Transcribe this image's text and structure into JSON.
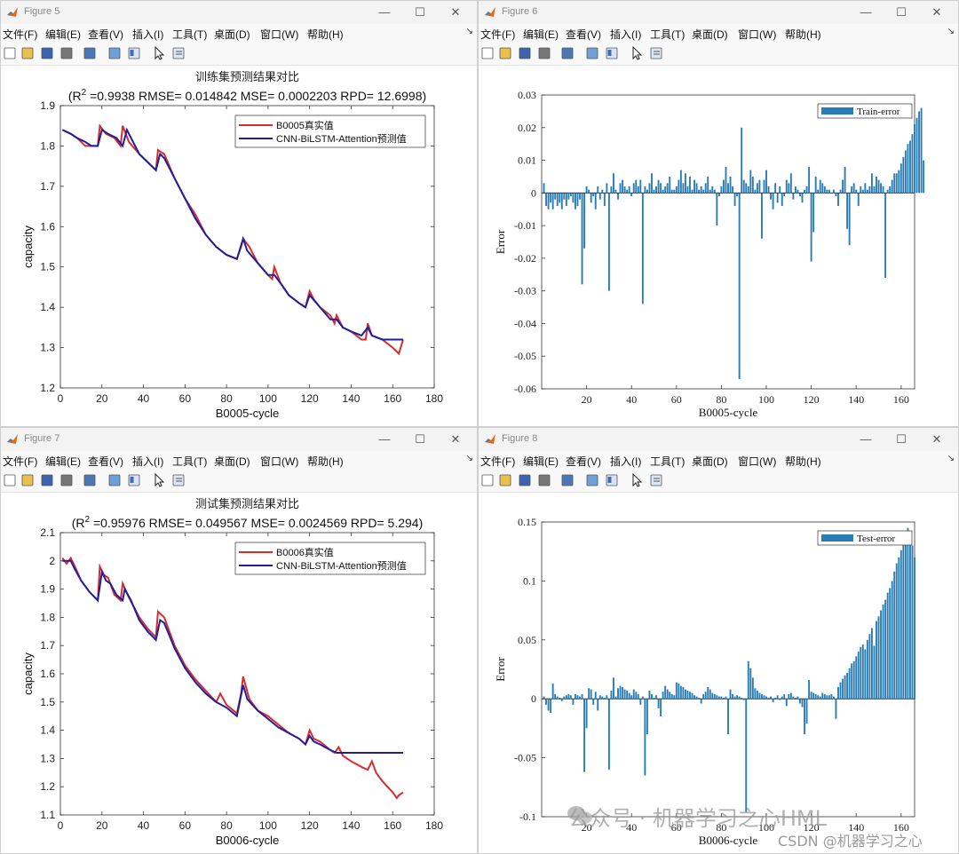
{
  "menu": [
    "文件(F)",
    "编辑(E)",
    "查看(V)",
    "插入(I)",
    "工具(T)",
    "桌面(D)",
    "窗口(W)",
    "帮助(H)"
  ],
  "window_controls": {
    "minimize": "—",
    "maximize": "☐",
    "close": "✕"
  },
  "toolbar_icons": [
    "new-figure-icon",
    "open-file-icon",
    "save-icon",
    "print-icon",
    "link-plot-icon",
    "colorbar-icon",
    "legend-icon",
    "edit-plot-icon",
    "property-inspector-icon"
  ],
  "windows": [
    {
      "title": "Figure 5",
      "chart_data": {
        "type": "line",
        "title": "训练集预测结果对比",
        "subtitle": {
          "r2_label": "(R",
          "r2_sup": "2",
          "rest": " =0.9938 RMSE= 0.014842 MSE= 0.0002203 RPD= 12.6998)"
        },
        "xlabel": "B0005-cycle",
        "ylabel": "capacity",
        "xlim": [
          0,
          180
        ],
        "ylim": [
          1.2,
          1.9
        ],
        "xticks": [
          "0",
          "20",
          "40",
          "60",
          "80",
          "100",
          "120",
          "140",
          "160",
          "180"
        ],
        "yticks": [
          "1.2",
          "1.3",
          "1.4",
          "1.5",
          "1.6",
          "1.7",
          "1.8",
          "1.9"
        ],
        "legend_position": "top-right",
        "series": [
          {
            "name": "B0005真实值",
            "color": "#d92b2b",
            "x": [
              1,
              5,
              8,
              12,
              15,
              18,
              19,
              22,
              26,
              29,
              30,
              33,
              38,
              42,
              46,
              47,
              50,
              55,
              60,
              65,
              70,
              75,
              80,
              85,
              87,
              88,
              91,
              95,
              100,
              102,
              103,
              106,
              110,
              115,
              118,
              120,
              122,
              125,
              130,
              132,
              133,
              136,
              140,
              145,
              147,
              148,
              150,
              155,
              160,
              162,
              163,
              165
            ],
            "y": [
              1.84,
              1.83,
              1.82,
              1.8,
              1.8,
              1.8,
              1.85,
              1.83,
              1.82,
              1.8,
              1.85,
              1.81,
              1.78,
              1.76,
              1.74,
              1.79,
              1.78,
              1.72,
              1.67,
              1.63,
              1.58,
              1.55,
              1.53,
              1.52,
              1.55,
              1.57,
              1.55,
              1.51,
              1.48,
              1.47,
              1.5,
              1.46,
              1.43,
              1.41,
              1.4,
              1.44,
              1.42,
              1.4,
              1.38,
              1.36,
              1.38,
              1.35,
              1.34,
              1.32,
              1.32,
              1.36,
              1.33,
              1.32,
              1.3,
              1.29,
              1.285,
              1.32
            ]
          },
          {
            "name": "CNN-BiLSTM-Attention预测值",
            "color": "#1f1f9e",
            "x": [
              1,
              5,
              8,
              12,
              15,
              18,
              20,
              23,
              27,
              30,
              32,
              34,
              38,
              42,
              46,
              48,
              50,
              55,
              60,
              65,
              70,
              75,
              80,
              85,
              88,
              90,
              95,
              100,
              103,
              106,
              110,
              115,
              118,
              120,
              125,
              130,
              133,
              136,
              140,
              145,
              148,
              150,
              155,
              160,
              163,
              165
            ],
            "y": [
              1.84,
              1.83,
              1.82,
              1.81,
              1.8,
              1.8,
              1.84,
              1.83,
              1.82,
              1.8,
              1.84,
              1.82,
              1.78,
              1.76,
              1.74,
              1.78,
              1.77,
              1.72,
              1.67,
              1.62,
              1.58,
              1.55,
              1.53,
              1.52,
              1.57,
              1.54,
              1.51,
              1.48,
              1.48,
              1.46,
              1.43,
              1.41,
              1.4,
              1.43,
              1.4,
              1.37,
              1.37,
              1.35,
              1.34,
              1.33,
              1.35,
              1.33,
              1.32,
              1.32,
              1.32,
              1.32
            ]
          }
        ]
      }
    },
    {
      "title": "Figure 6",
      "chart_data": {
        "type": "bar",
        "xlabel": "B0005-cycle",
        "ylabel": "Error",
        "xlim": [
          0,
          166
        ],
        "ylim": [
          -0.06,
          0.03
        ],
        "xticks": [
          "20",
          "40",
          "60",
          "80",
          "100",
          "120",
          "140",
          "160"
        ],
        "yticks": [
          "-0.06",
          "-0.05",
          "-0.04",
          "-0.03",
          "-0.02",
          "-0.01",
          "0",
          "0.01",
          "0.02",
          "0.03"
        ],
        "legend_position": "top-right",
        "series": [
          {
            "name": "Train-error",
            "color": "#2a7db4",
            "values": [
              0.003,
              -0.004,
              -0.005,
              -0.003,
              -0.005,
              -0.002,
              -0.004,
              -0.003,
              -0.005,
              -0.002,
              -0.004,
              -0.002,
              -0.001,
              -0.003,
              -0.005,
              -0.004,
              -0.002,
              -0.028,
              -0.017,
              0.002,
              0.001,
              -0.003,
              -0.001,
              -0.005,
              0.002,
              -0.002,
              0.001,
              -0.004,
              0.003,
              -0.03,
              0.002,
              0.006,
              0.001,
              -0.002,
              0.003,
              0.004,
              0.002,
              0.001,
              0.002,
              -0.001,
              0.003,
              0.004,
              0.002,
              0.004,
              -0.034,
              0.002,
              0.001,
              0.003,
              0.006,
              0.001,
              0.002,
              0.004,
              0.003,
              0.001,
              0.002,
              0.003,
              0.005,
              0.001,
              0.001,
              0.002,
              0.004,
              0.007,
              0.003,
              0.006,
              0.002,
              0.005,
              0.001,
              0.004,
              0.003,
              0.001,
              0.002,
              0.001,
              0.003,
              0.005,
              0.001,
              0.002,
              0.001,
              -0.01,
              -0.001,
              0.002,
              0.004,
              0.008,
              0.003,
              0.005,
              0.002,
              -0.004,
              -0.001,
              -0.057,
              0.02,
              0.004,
              0.003,
              0.002,
              0.007,
              0.005,
              0.001,
              0.003,
              0.004,
              -0.014,
              0.004,
              0.007,
              0.002,
              -0.002,
              -0.005,
              0.003,
              -0.003,
              0.002,
              -0.004,
              -0.001,
              0.004,
              0.003,
              0.006,
              -0.002,
              0.002,
              0.001,
              -0.001,
              -0.003,
              0.001,
              0.002,
              0.008,
              -0.021,
              -0.012,
              0.005,
              0.001,
              0.004,
              0.003,
              0.002,
              0.001,
              0.001,
              0.0,
              0.001,
              -0.001,
              -0.004,
              0.001,
              0.004,
              0.008,
              -0.011,
              -0.016,
              0.002,
              0.003,
              0.001,
              -0.004,
              0.002,
              0.001,
              0.003,
              0.001,
              0.002,
              0.006,
              0.002,
              0.005,
              0.004,
              0.003,
              0.002,
              -0.026,
              0.001,
              0.002,
              0.004,
              0.006,
              0.006,
              0.007,
              0.009,
              0.011,
              0.013,
              0.015,
              0.016,
              0.018,
              0.021,
              0.023,
              0.025,
              0.026,
              0.01
            ]
          }
        ]
      }
    },
    {
      "title": "Figure 7",
      "chart_data": {
        "type": "line",
        "title": "测试集预测结果对比",
        "subtitle": {
          "r2_label": "(R",
          "r2_sup": "2",
          "rest": " =0.95976 RMSE= 0.049567 MSE= 0.0024569 RPD= 5.294)"
        },
        "xlabel": "B0006-cycle",
        "ylabel": "capacity",
        "xlim": [
          0,
          180
        ],
        "ylim": [
          1.1,
          2.1
        ],
        "xticks": [
          "0",
          "20",
          "40",
          "60",
          "80",
          "100",
          "120",
          "140",
          "160",
          "180"
        ],
        "yticks": [
          "1.1",
          "1.2",
          "1.3",
          "1.4",
          "1.5",
          "1.6",
          "1.7",
          "1.8",
          "1.9",
          "2",
          "2.1"
        ],
        "legend_position": "top-right",
        "series": [
          {
            "name": "B0006真实值",
            "color": "#d92b2b",
            "x": [
              1,
              3,
              5,
              7,
              10,
              14,
              18,
              19,
              21,
              23,
              26,
              29,
              30,
              33,
              38,
              42,
              46,
              47,
              50,
              55,
              60,
              65,
              70,
              75,
              77,
              80,
              85,
              87,
              88,
              91,
              95,
              100,
              105,
              110,
              115,
              118,
              120,
              122,
              125,
              130,
              132,
              134,
              136,
              140,
              145,
              148,
              150,
              152,
              155,
              160,
              162,
              163,
              165
            ],
            "y": [
              2.01,
              1.99,
              2.01,
              1.98,
              1.93,
              1.89,
              1.86,
              1.98,
              1.95,
              1.94,
              1.88,
              1.86,
              1.92,
              1.87,
              1.8,
              1.76,
              1.73,
              1.82,
              1.8,
              1.7,
              1.63,
              1.58,
              1.54,
              1.5,
              1.53,
              1.49,
              1.46,
              1.53,
              1.59,
              1.51,
              1.47,
              1.45,
              1.42,
              1.39,
              1.37,
              1.35,
              1.4,
              1.37,
              1.36,
              1.33,
              1.32,
              1.34,
              1.31,
              1.29,
              1.27,
              1.26,
              1.29,
              1.25,
              1.22,
              1.18,
              1.16,
              1.17,
              1.18
            ]
          },
          {
            "name": "CNN-BiLSTM-Attention预测值",
            "color": "#1f1f9e",
            "x": [
              1,
              3,
              5,
              7,
              10,
              14,
              18,
              20,
              22,
              24,
              27,
              30,
              31,
              34,
              38,
              42,
              46,
              48,
              50,
              55,
              60,
              65,
              70,
              75,
              80,
              85,
              88,
              90,
              95,
              100,
              105,
              110,
              115,
              118,
              120,
              122,
              125,
              130,
              133,
              135,
              140,
              145,
              150,
              160,
              165
            ],
            "y": [
              2.0,
              2.0,
              2.0,
              1.97,
              1.93,
              1.89,
              1.86,
              1.96,
              1.93,
              1.92,
              1.88,
              1.86,
              1.9,
              1.86,
              1.79,
              1.75,
              1.72,
              1.79,
              1.78,
              1.69,
              1.62,
              1.57,
              1.53,
              1.5,
              1.48,
              1.45,
              1.56,
              1.51,
              1.47,
              1.44,
              1.41,
              1.39,
              1.37,
              1.35,
              1.38,
              1.36,
              1.35,
              1.33,
              1.32,
              1.32,
              1.32,
              1.32,
              1.32,
              1.32,
              1.32
            ]
          }
        ]
      }
    },
    {
      "title": "Figure 8",
      "chart_data": {
        "type": "bar",
        "xlabel": "B0006-cycle",
        "ylabel": "Error",
        "xlim": [
          0,
          166
        ],
        "ylim": [
          -0.1,
          0.15
        ],
        "xticks": [
          "20",
          "40",
          "60",
          "80",
          "100",
          "120",
          "140",
          "160"
        ],
        "yticks": [
          "-0.1",
          "-0.05",
          "0",
          "0.05",
          "0.1",
          "0.15"
        ],
        "legend_position": "top-right",
        "series": [
          {
            "name": "Test-error",
            "color": "#2a7db4",
            "values": [
              0.002,
              -0.005,
              -0.01,
              -0.012,
              0.013,
              0.004,
              0.002,
              0.001,
              -0.002,
              0.002,
              0.003,
              0.004,
              0.003,
              -0.005,
              0.004,
              0.003,
              0.002,
              0.004,
              -0.062,
              -0.025,
              0.009,
              0.008,
              -0.005,
              0.006,
              -0.01,
              0.003,
              0.002,
              0.001,
              0.003,
              -0.06,
              0.007,
              0.018,
              0.002,
              0.009,
              0.011,
              0.01,
              0.008,
              0.007,
              0.005,
              0.003,
              0.008,
              0.006,
              0.004,
              -0.005,
              0.002,
              -0.065,
              -0.03,
              0.007,
              0.004,
              0.001,
              0.003,
              -0.008,
              -0.015,
              0.006,
              0.011,
              0.008,
              0.006,
              0.004,
              0.003,
              0.014,
              0.013,
              0.011,
              0.01,
              0.008,
              0.007,
              0.006,
              0.005,
              0.003,
              0.002,
              0.001,
              -0.004,
              0.004,
              0.006,
              0.01,
              0.008,
              0.005,
              0.004,
              0.003,
              0.002,
              0.002,
              0.001,
              0.002,
              -0.03,
              0.008,
              0.004,
              0.002,
              0.003,
              0.002,
              0.001,
              -0.001,
              -0.096,
              0.032,
              0.026,
              0.018,
              0.009,
              0.007,
              0.005,
              0.004,
              0.003,
              0.002,
              0.001,
              0.002,
              -0.003,
              0.001,
              0.003,
              -0.001,
              0.002,
              0.004,
              -0.006,
              0.004,
              0.005,
              0.002,
              0.001,
              0.002,
              -0.004,
              -0.007,
              -0.03,
              -0.021,
              0.016,
              0.006,
              0.005,
              0.004,
              0.003,
              0.002,
              0.005,
              0.004,
              0.003,
              0.003,
              0.004,
              0.002,
              -0.017,
              0.01,
              0.014,
              0.017,
              0.02,
              0.022,
              0.026,
              0.03,
              0.032,
              0.036,
              0.04,
              0.044,
              0.046,
              0.042,
              0.05,
              0.055,
              0.06,
              0.045,
              0.066,
              0.07,
              0.075,
              0.08,
              0.084,
              0.09,
              0.094,
              0.1,
              0.108,
              0.115,
              0.12,
              0.126,
              0.132,
              0.138,
              0.145,
              0.138,
              0.13,
              0.12
            ]
          }
        ]
      }
    }
  ],
  "watermark": {
    "text": "公众号 · 机器学习之心HML",
    "csdn": "CSDN @机器学习之心"
  }
}
